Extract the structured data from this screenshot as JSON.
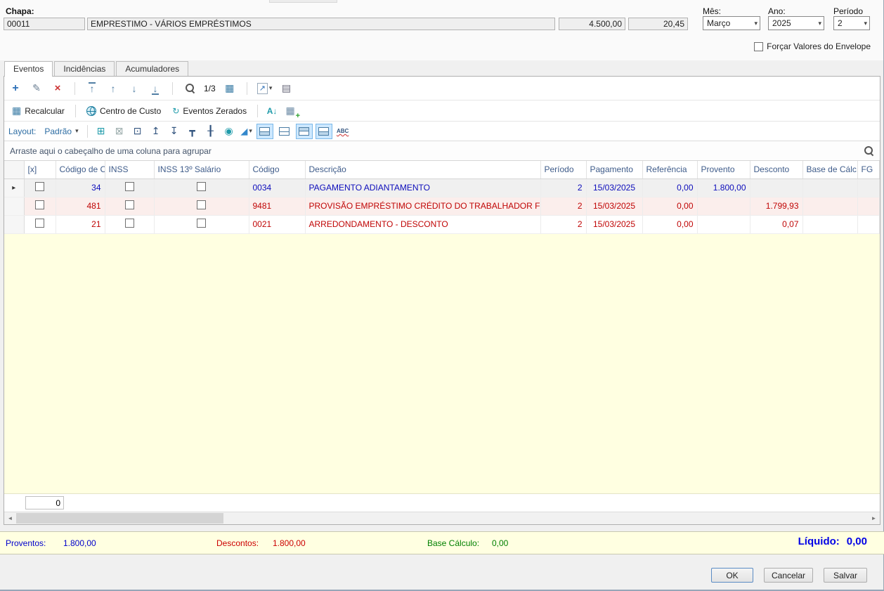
{
  "header": {
    "chapa_label": "Chapa:",
    "chapa_value": "00011",
    "employee_name": "EMPRESTIMO - VÁRIOS EMPRÉSTIMOS",
    "salary": "4.500,00",
    "rate": "20,45",
    "mes_label": "Mês:",
    "mes_value": "Março",
    "ano_label": "Ano:",
    "ano_value": "2025",
    "periodo_label": "Período",
    "periodo_value": "2",
    "forcar_valores_label": "Forçar Valores do Envelope"
  },
  "tabs": {
    "eventos": "Eventos",
    "incidencias": "Incidências",
    "acumuladores": "Acumuladores"
  },
  "toolbar": {
    "pager": "1/3"
  },
  "actions_bar": {
    "recalcular": "Recalcular",
    "centro_custo": "Centro de Custo",
    "eventos_zerados": "Eventos Zerados"
  },
  "layout_bar": {
    "label": "Layout:",
    "preset": "Padrão",
    "spellcheck": "ABC"
  },
  "group_bar": {
    "hint": "Arraste aqui o cabeçalho de uma coluna para agrupar"
  },
  "icons": {
    "add": "+",
    "edit": "✎",
    "delete": "×",
    "nav_first": "↑",
    "nav_prev": "↑",
    "nav_next": "↓",
    "nav_last": "↓",
    "grid_view": "▦",
    "export": "↗",
    "caret": "▾",
    "report": "▤",
    "recalc": "▦",
    "refresh": "↻",
    "sort_az": "A↓",
    "add_table": "▦",
    "expand": "⊞",
    "collapse": "⊠",
    "band": "⊡",
    "row_up": "↥",
    "row_down": "↧",
    "pin": "┳",
    "freeze": "╂",
    "sphere": "◉",
    "chart": "◢",
    "scroll_left": "◄",
    "scroll_right": "►",
    "row_marker": "▸"
  },
  "grid": {
    "columns": [
      "[x]",
      "Código de C...",
      "INSS",
      "INSS 13º Salário",
      "Código",
      "Descrição",
      "Período",
      "Pagamento",
      "Referência",
      "Provento",
      "Desconto",
      "Base de Cálc...",
      "FG"
    ],
    "rows": [
      {
        "selected": true,
        "checked": false,
        "codigo_calculo": "34",
        "inss": false,
        "inss_13": false,
        "codigo": "0034",
        "descricao": "PAGAMENTO ADIANTAMENTO",
        "periodo": "2",
        "pagamento": "15/03/2025",
        "referencia": "0,00",
        "provento": "1.800,00",
        "desconto": "",
        "base_calculo": "",
        "tipo": "provento"
      },
      {
        "selected": false,
        "checked": false,
        "codigo_calculo": "481",
        "inss": false,
        "inss_13": false,
        "codigo": "9481",
        "descricao": "PROVISÃO EMPRÉSTIMO CRÉDITO DO TRABALHADOR FOLHA",
        "periodo": "2",
        "pagamento": "15/03/2025",
        "referencia": "0,00",
        "provento": "",
        "desconto": "1.799,93",
        "base_calculo": "",
        "tipo": "desconto"
      },
      {
        "selected": false,
        "checked": false,
        "codigo_calculo": "21",
        "inss": false,
        "inss_13": false,
        "codigo": "0021",
        "descricao": "ARREDONDAMENTO - DESCONTO",
        "periodo": "2",
        "pagamento": "15/03/2025",
        "referencia": "0,00",
        "provento": "",
        "desconto": "0,07",
        "base_calculo": "",
        "tipo": "desconto"
      }
    ],
    "footer_count": "0"
  },
  "totals": {
    "proventos_label": "Proventos:",
    "proventos_value": "1.800,00",
    "descontos_label": "Descontos:",
    "descontos_value": "1.800,00",
    "base_label": "Base Cálculo:",
    "base_value": "0,00",
    "liquido_label": "Líquido:",
    "liquido_value": "0,00"
  },
  "footer_buttons": {
    "ok": "OK",
    "cancelar": "Cancelar",
    "salvar": "Salvar"
  },
  "colors": {
    "provento_text": "#0d0dbb",
    "desconto_text": "#c00505",
    "base_text": "#008000",
    "liquido_text": "#0000e6",
    "filler_yellow": "#ffffe1",
    "selected_row_bg": "#f0f0f0",
    "desconto_row_bg": "#fbeeec",
    "accent_blue": "#2d6da3"
  }
}
